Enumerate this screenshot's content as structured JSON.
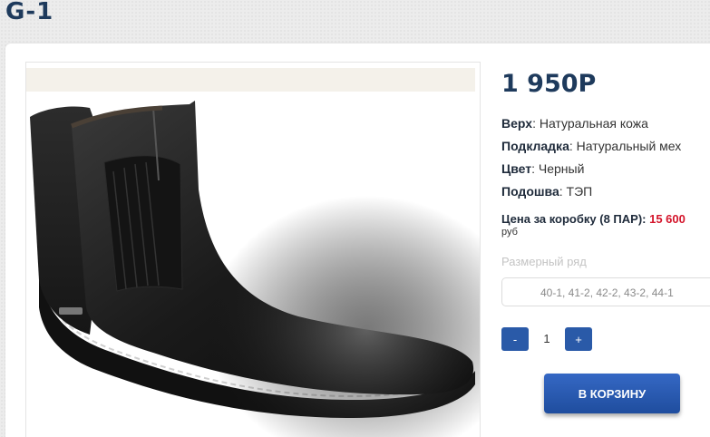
{
  "product": {
    "title": "G-1",
    "price": "1 950Р",
    "specs": [
      {
        "label": "Верх",
        "value": "Натуральная кожа"
      },
      {
        "label": "Подкладка",
        "value": "Натуральный мех"
      },
      {
        "label": "Цвет",
        "value": "Черный"
      },
      {
        "label": "Подошва",
        "value": "ТЭП"
      }
    ],
    "box_price_label": "Цена за коробку (8 ПАР):",
    "box_price_value": "15 600",
    "box_price_currency": "руб",
    "size_label": "Размерный ряд",
    "size_range": "40-1, 41-2, 42-2, 43-2, 44-1",
    "image_icon": "black-leather-chelsea-boot"
  },
  "quantity": {
    "minus_label": "-",
    "value": "1",
    "plus_label": "+"
  },
  "cart": {
    "button_label": "В КОРЗИНУ"
  },
  "colors": {
    "accent": "#2a5aa8",
    "title": "#1e3a5c",
    "price_red": "#d4152b"
  }
}
